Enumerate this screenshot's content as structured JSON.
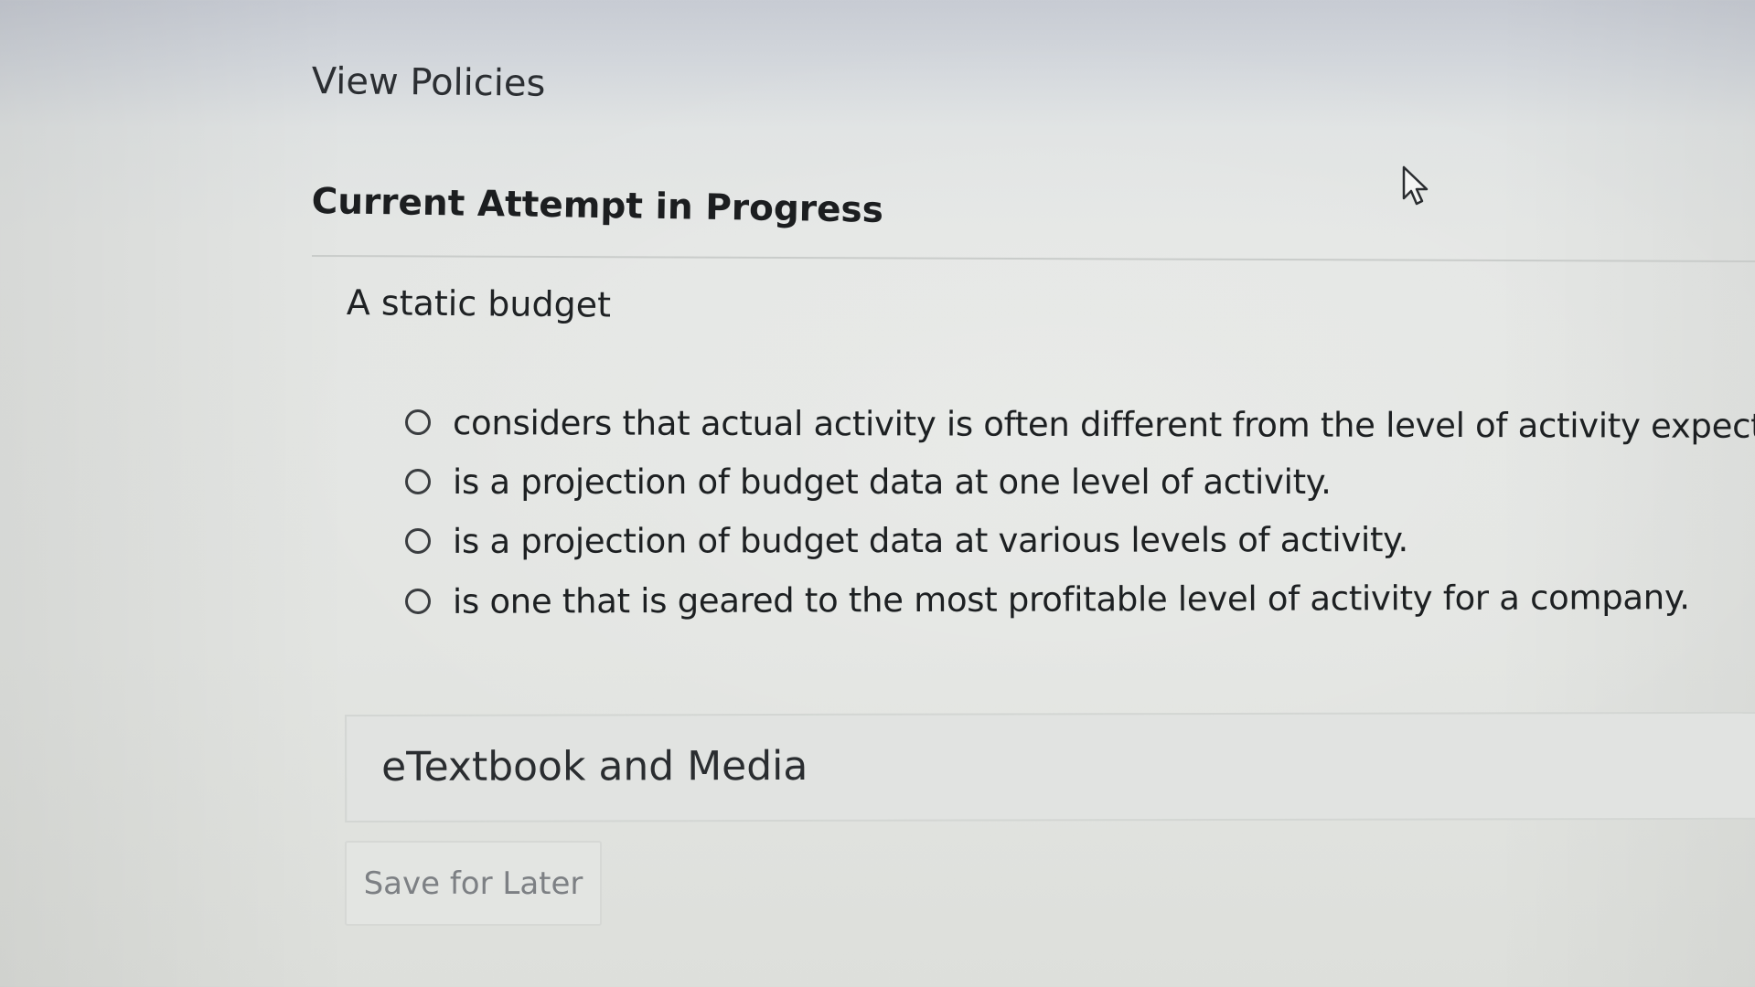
{
  "header": {
    "view_policies": "View Policies"
  },
  "attempt": {
    "title": "Current Attempt in Progress"
  },
  "question": {
    "prompt": "A static budget",
    "options": [
      {
        "label": "considers that actual activity is often different from the level of activity expected.",
        "selected": false
      },
      {
        "label": "is a projection of budget data at one level of activity.",
        "selected": false
      },
      {
        "label": "is a projection of budget data at various levels of activity.",
        "selected": false
      },
      {
        "label": "is one that is geared to the most profitable level of activity for a company.",
        "selected": false
      }
    ]
  },
  "resources": {
    "etextbook_label": "eTextbook and Media"
  },
  "actions": {
    "save_later_label": "Save for Later"
  },
  "icons": {
    "radio": "radio-unchecked-icon",
    "cursor": "mouse-pointer-icon"
  },
  "colors": {
    "text": "#1f2224",
    "muted_button_text": "#7d8084",
    "panel_bg": "#e1e3e1"
  }
}
